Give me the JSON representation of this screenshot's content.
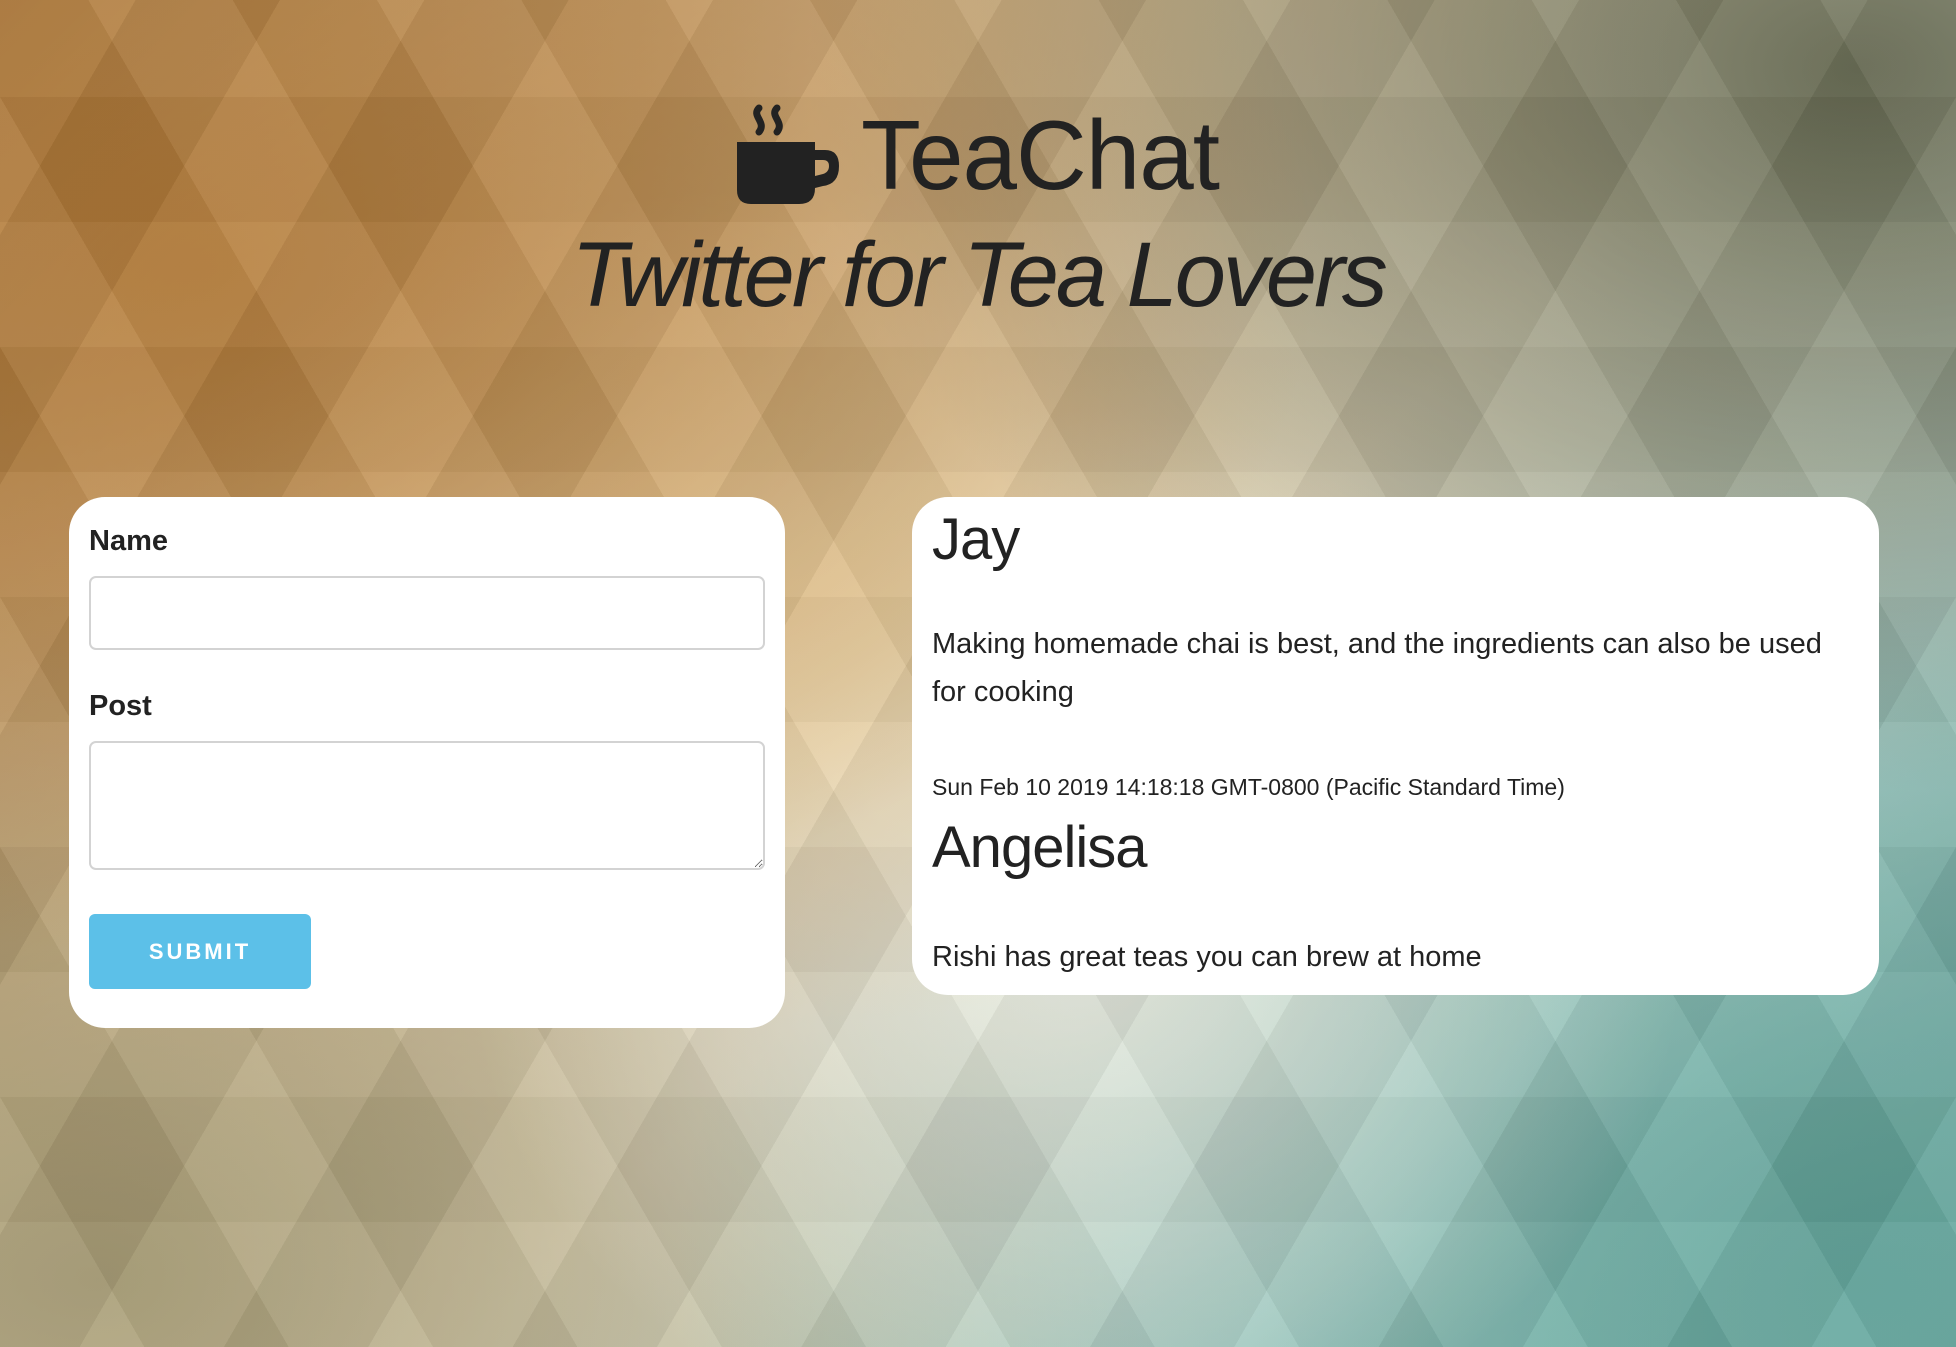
{
  "header": {
    "brand_icon": "coffee-cup-icon",
    "brand_name": "TeaChat",
    "tagline": "Twitter for Tea Lovers"
  },
  "form": {
    "name_label": "Name",
    "name_value": "",
    "post_label": "Post",
    "post_value": "",
    "submit_label": "SUBMIT"
  },
  "feed": {
    "posts": [
      {
        "author": "Jay",
        "body": "Making homemade chai is best, and the ingredients can also be used for cooking",
        "timestamp": "Sun Feb 10 2019 14:18:18 GMT-0800 (Pacific Standard Time)"
      },
      {
        "author": "Angelisa",
        "body": "Rishi has great teas you can brew at home",
        "timestamp": ""
      }
    ]
  },
  "colors": {
    "accent": "#5cc0e8",
    "text": "#222222",
    "panel": "#ffffff"
  }
}
